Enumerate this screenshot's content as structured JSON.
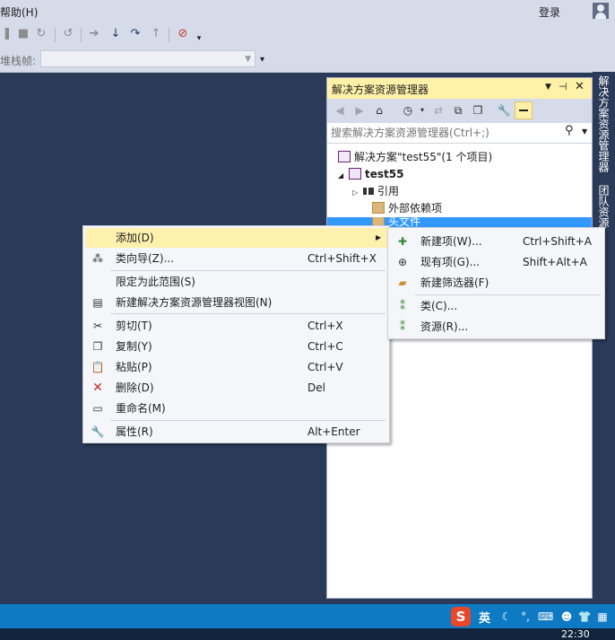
{
  "menubar": {
    "help": "帮助(H)",
    "login": "登录"
  },
  "toolbar": {
    "icons": [
      "pause-icon",
      "stop-icon",
      "restart-icon",
      "hot-reload-icon",
      "show-next-statement-icon",
      "step-into-icon",
      "step-over-icon",
      "step-out-icon",
      "breakpoint-disable-icon"
    ],
    "stack_label": "堆栈帧:",
    "stack_value": ""
  },
  "solution_explorer": {
    "title": "解决方案资源管理器",
    "search_placeholder": "搜索解决方案资源管理器(Ctrl+;)",
    "tree": {
      "solution": "解决方案\"test55\"(1 个项目)",
      "project": "test55",
      "references": "引用",
      "external_deps": "外部依赖项",
      "headers": "头文件"
    }
  },
  "side_tabs": [
    "解决方案资源管理器",
    "团队资源"
  ],
  "context_menu": {
    "items": [
      {
        "icon": "",
        "label": "添加(D)",
        "shortcut": "",
        "submenu": true
      },
      {
        "icon": "class-wizard-icon",
        "label": "类向导(Z)...",
        "shortcut": "Ctrl+Shift+X"
      },
      {
        "icon": "",
        "label": "限定为此范围(S)",
        "shortcut": ""
      },
      {
        "icon": "new-view-icon",
        "label": "新建解决方案资源管理器视图(N)",
        "shortcut": ""
      },
      {
        "icon": "cut-icon",
        "label": "剪切(T)",
        "shortcut": "Ctrl+X"
      },
      {
        "icon": "copy-icon",
        "label": "复制(Y)",
        "shortcut": "Ctrl+C"
      },
      {
        "icon": "paste-icon",
        "label": "粘贴(P)",
        "shortcut": "Ctrl+V"
      },
      {
        "icon": "delete-icon",
        "label": "删除(D)",
        "shortcut": "Del"
      },
      {
        "icon": "rename-icon",
        "label": "重命名(M)",
        "shortcut": ""
      },
      {
        "icon": "wrench-icon",
        "label": "属性(R)",
        "shortcut": "Alt+Enter"
      }
    ]
  },
  "submenu": {
    "items": [
      {
        "icon": "new-item-icon",
        "label": "新建项(W)...",
        "shortcut": "Ctrl+Shift+A"
      },
      {
        "icon": "existing-item-icon",
        "label": "现有项(G)...",
        "shortcut": "Shift+Alt+A"
      },
      {
        "icon": "new-filter-icon",
        "label": "新建筛选器(F)",
        "shortcut": ""
      },
      {
        "icon": "class-icon",
        "label": "类(C)...",
        "shortcut": ""
      },
      {
        "icon": "resource-icon",
        "label": "资源(R)...",
        "shortcut": ""
      }
    ]
  },
  "statusbar": {
    "ime_badge": "S",
    "ime_lang": "英",
    "clock": "22:30"
  },
  "colors": {
    "accent": "#0e7ac4",
    "highlight": "#fef1ad",
    "selection": "#3399ff",
    "title_active": "#fff1a8"
  }
}
